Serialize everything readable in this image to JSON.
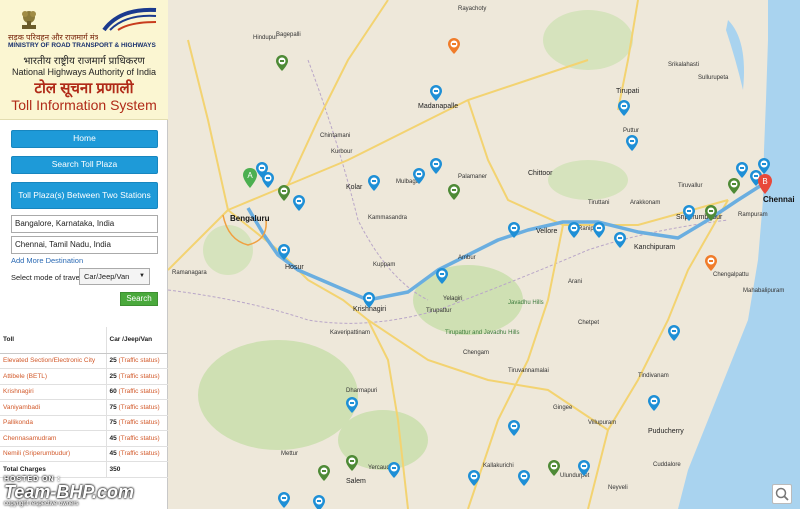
{
  "header": {
    "ministry_hindi": "सड़क परिवहन और राजमार्ग मंत्रालय",
    "ministry_english": "MINISTRY OF ROAD TRANSPORT & HIGHWAYS",
    "nhai_hindi": "भारतीय राष्ट्रीय राजमार्ग प्राधिकरण",
    "nhai_english": "National Highways Authority of India",
    "title_hindi": "टोल सूचना प्रणाली",
    "title_english": "Toll Information System"
  },
  "nav": {
    "home": "Home",
    "search_toll_plaza": "Search Toll Plaza",
    "between_stations": "Toll Plaza(s) Between Two Stations"
  },
  "form": {
    "from_value": "Bangalore, Karnataka, India",
    "to_value": "Chennai, Tamil Nadu, India",
    "add_destination": "Add More Destination",
    "mode_label": "Select mode of travel",
    "mode_value": "Car/Jeep/Van",
    "search_button": "Search"
  },
  "table": {
    "col_toll": "Toll",
    "col_car": "Car /Jeep/Van",
    "rows": [
      {
        "name": "Elevated Section/Electronic City",
        "fee": "25",
        "status": "(Traffic status)"
      },
      {
        "name": "Attibele (BETL)",
        "fee": "25",
        "status": "(Traffic status)"
      },
      {
        "name": "Krishnagiri",
        "fee": "60",
        "status": "(Traffic status)"
      },
      {
        "name": "Vaniyambadi",
        "fee": "75",
        "status": "(Traffic status)"
      },
      {
        "name": "Pallikonda",
        "fee": "75",
        "status": "(Traffic status)"
      },
      {
        "name": "Chennasamudram",
        "fee": "45",
        "status": "(Traffic status)"
      },
      {
        "name": "Nemili (Sriperumbudur)",
        "fee": "45",
        "status": "(Traffic status)"
      }
    ],
    "total_label": "Total Charges",
    "total_value": "350"
  },
  "map": {
    "towns": [
      {
        "name": "Bengaluru",
        "cls": "big"
      },
      {
        "name": "Chennai",
        "cls": "big"
      },
      {
        "name": "Hosur",
        "cls": "mid"
      },
      {
        "name": "Krishnagiri",
        "cls": "mid"
      },
      {
        "name": "Vellore",
        "cls": "mid"
      },
      {
        "name": "Kanchipuram",
        "cls": "mid"
      },
      {
        "name": "Sriperumbudur",
        "cls": "mid"
      },
      {
        "name": "Tirupati",
        "cls": "mid"
      },
      {
        "name": "Chittoor",
        "cls": "mid"
      },
      {
        "name": "Kolar",
        "cls": "mid"
      },
      {
        "name": "Hindupur",
        "cls": ""
      },
      {
        "name": "Madanapalle",
        "cls": "mid"
      },
      {
        "name": "Puttur",
        "cls": ""
      },
      {
        "name": "Tiruvallur",
        "cls": ""
      },
      {
        "name": "Arakkonam",
        "cls": ""
      },
      {
        "name": "Chengalpattu",
        "cls": ""
      },
      {
        "name": "Puducherry",
        "cls": "mid"
      },
      {
        "name": "Salem",
        "cls": "mid"
      },
      {
        "name": "Dharmapuri",
        "cls": ""
      },
      {
        "name": "Tiruvannamalai",
        "cls": ""
      },
      {
        "name": "Villupuram",
        "cls": ""
      },
      {
        "name": "Tindivanam",
        "cls": ""
      },
      {
        "name": "Ranipet",
        "cls": ""
      },
      {
        "name": "Arani",
        "cls": ""
      },
      {
        "name": "Chetpet",
        "cls": ""
      },
      {
        "name": "Gingee",
        "cls": ""
      },
      {
        "name": "Ambur",
        "cls": ""
      },
      {
        "name": "Tirupattur",
        "cls": ""
      },
      {
        "name": "Chengam",
        "cls": ""
      },
      {
        "name": "Kuppam",
        "cls": ""
      },
      {
        "name": "Palamaner",
        "cls": ""
      },
      {
        "name": "Mulbagal",
        "cls": ""
      },
      {
        "name": "Chintamani",
        "cls": ""
      },
      {
        "name": "Ramanagara",
        "cls": ""
      },
      {
        "name": "Kallakurichi",
        "cls": ""
      },
      {
        "name": "Cuddalore",
        "cls": ""
      },
      {
        "name": "Neyveli",
        "cls": ""
      },
      {
        "name": "Ulundurpet",
        "cls": ""
      },
      {
        "name": "Mettur",
        "cls": ""
      },
      {
        "name": "Yercaud",
        "cls": ""
      },
      {
        "name": "Kaveripattinam",
        "cls": ""
      },
      {
        "name": "Mahabalipuram",
        "cls": ""
      },
      {
        "name": "Sullurupeta",
        "cls": ""
      },
      {
        "name": "Srikalahasti",
        "cls": ""
      },
      {
        "name": "Rayachoty",
        "cls": ""
      },
      {
        "name": "Bagepalli",
        "cls": ""
      },
      {
        "name": "Kurbour",
        "cls": ""
      },
      {
        "name": "Kammasandra",
        "cls": ""
      },
      {
        "name": "Rampuram",
        "cls": ""
      },
      {
        "name": "Tiruttani",
        "cls": ""
      },
      {
        "name": "Yelagiri",
        "cls": ""
      },
      {
        "name": "Tirupattur and Javadhu Hills",
        "cls": "park"
      },
      {
        "name": "Javadhu Hills",
        "cls": "park"
      }
    ],
    "pin_a": "A",
    "pin_b": "B"
  },
  "watermark": {
    "hosted": "HOSTED ON :",
    "brand": "Team-BHP.com",
    "copyright": "copyright respective owners"
  },
  "colors": {
    "route": "#6aaee0",
    "nav_button": "#1e9ad8",
    "search_button": "#4aa93c",
    "toll_text": "#d2592a",
    "title_red": "#b02a18",
    "sea": "#a9d3ef",
    "land": "#eee8da"
  }
}
